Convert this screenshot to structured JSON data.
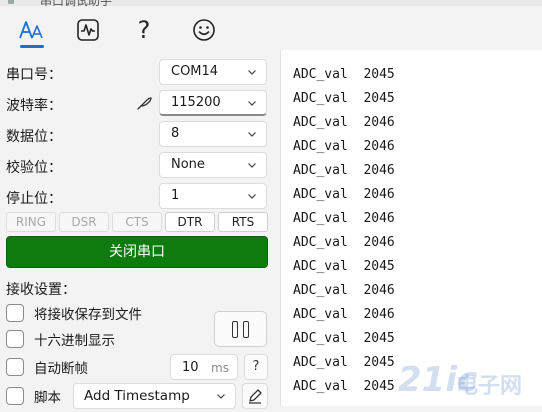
{
  "window": {
    "title": "串口调试助手"
  },
  "toolbar": {
    "icons": [
      "font-settings-icon",
      "waveform-icon",
      "help-icon",
      "smiley-icon"
    ],
    "help_glyph": "?",
    "accent": "#1a6fd1"
  },
  "serial": {
    "port_label": "串口号：",
    "port_value": "COM14",
    "baud_label": "波特率：",
    "baud_value": "115200",
    "databits_label": "数据位：",
    "databits_value": "8",
    "parity_label": "校验位：",
    "parity_value": "None",
    "stopbits_label": "停止位：",
    "stopbits_value": "1"
  },
  "signals": [
    {
      "label": "RING",
      "active": false
    },
    {
      "label": "DSR",
      "active": false
    },
    {
      "label": "CTS",
      "active": false
    },
    {
      "label": "DTR",
      "active": true
    },
    {
      "label": "RTS",
      "active": true
    }
  ],
  "open_button": {
    "label": "关闭串口",
    "color": "#0f7b0f"
  },
  "receive": {
    "title": "接收设置：",
    "save_to_file": "将接收保存到文件",
    "hex_display": "十六进制显示",
    "auto_break": "自动断帧",
    "break_ms_value": "10",
    "break_ms_unit": "ms",
    "help": "?",
    "script_label": "脚本",
    "script_value": "Add Timestamp"
  },
  "output_lines": [
    "ADC_val  2045",
    "ADC_val  2045",
    "ADC_val  2046",
    "ADC_val  2046",
    "ADC_val  2046",
    "ADC_val  2046",
    "ADC_val  2046",
    "ADC_val  2046",
    "ADC_val  2045",
    "ADC_val  2046",
    "ADC_val  2046",
    "ADC_val  2045",
    "ADC_val  2045",
    "ADC_val  2045"
  ],
  "watermark": {
    "brand": "21ic",
    "text": "电子网"
  }
}
